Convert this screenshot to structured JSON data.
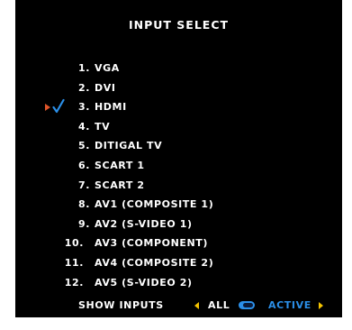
{
  "title": "INPUT SELECT",
  "colors": {
    "background": "#000000",
    "text": "#ffffff",
    "selection_arrow": "#e0552a",
    "checkmark": "#2b8fe8",
    "nav_arrows": "#f5c400",
    "active": "#2b8fe8"
  },
  "inputs": [
    {
      "number": "1.",
      "label": "VGA"
    },
    {
      "number": "2.",
      "label": "DVI"
    },
    {
      "number": "3.",
      "label": "HDMI",
      "selected": true
    },
    {
      "number": "4.",
      "label": "TV"
    },
    {
      "number": "5.",
      "label": "DITIGAL TV"
    },
    {
      "number": "6.",
      "label": "SCART 1"
    },
    {
      "number": "7.",
      "label": "SCART 2"
    },
    {
      "number": "8.",
      "label": "AV1 (COMPOSITE 1)"
    },
    {
      "number": "9.",
      "label": "AV2 (S-VIDEO 1)"
    },
    {
      "number": "10.",
      "label": "AV3 (COMPONENT)"
    },
    {
      "number": "11.",
      "label": "AV4 (COMPOSITE 2)"
    },
    {
      "number": "12.",
      "label": "AV5 (S-VIDEO 2)"
    }
  ],
  "footer": {
    "show_inputs_label": "SHOW INPUTS",
    "option_all": "ALL",
    "option_active": "ACTIVE",
    "selected_option": "ACTIVE"
  },
  "icons": {
    "selection": "triangle-right-icon",
    "check": "checkmark-icon",
    "prev": "arrow-left-icon",
    "next": "arrow-right-icon",
    "toggle": "toggle-switch-icon"
  }
}
